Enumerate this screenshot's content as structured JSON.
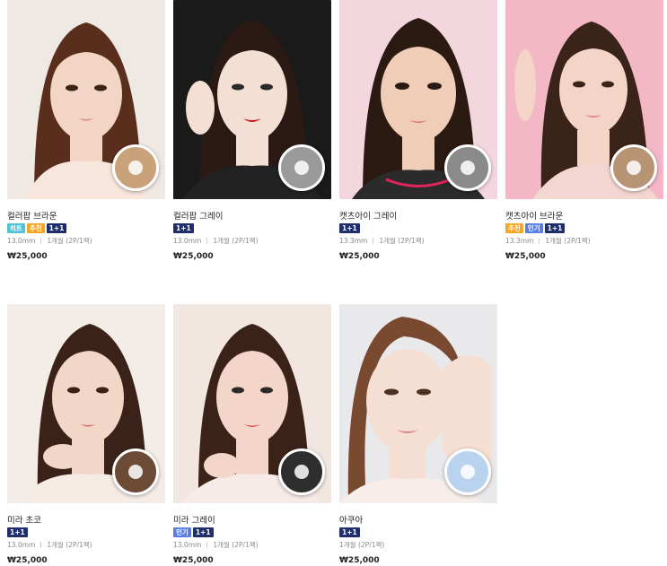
{
  "products": [
    {
      "name": "컬러팝 브라운",
      "badges": [
        {
          "label": "히트",
          "kind": "hit"
        },
        {
          "label": "추천",
          "kind": "rec"
        },
        {
          "label": "1+1",
          "kind": "one"
        }
      ],
      "diameter": "13.0mm",
      "package": "1개월 (2P/1팩)",
      "price": "₩25,000",
      "bg_color": "#efe9e4",
      "lens_color": "#c9a27a"
    },
    {
      "name": "컬러팝 그레이",
      "badges": [
        {
          "label": "1+1",
          "kind": "one"
        }
      ],
      "diameter": "13.0mm",
      "package": "1개월 (2P/1팩)",
      "price": "₩25,000",
      "bg_color": "#1a1a1a",
      "lens_color": "#9a9a9a"
    },
    {
      "name": "캣츠아이 그레이",
      "badges": [
        {
          "label": "1+1",
          "kind": "one"
        }
      ],
      "diameter": "13.3mm",
      "package": "1개월 (2P/1팩)",
      "price": "₩25,000",
      "bg_color": "#f4d6de",
      "lens_color": "#8a8a8a"
    },
    {
      "name": "캣츠아이 브라운",
      "badges": [
        {
          "label": "추천",
          "kind": "rec"
        },
        {
          "label": "인기",
          "kind": "pop"
        },
        {
          "label": "1+1",
          "kind": "one"
        }
      ],
      "diameter": "13.3mm",
      "package": "1개월 (2P/1팩)",
      "price": "₩25,000",
      "bg_color": "#f3b7c6",
      "lens_color": "#b79473"
    },
    {
      "name": "미라 초코",
      "badges": [
        {
          "label": "1+1",
          "kind": "one"
        }
      ],
      "diameter": "13.0mm",
      "package": "1개월 (2P/1팩)",
      "price": "₩25,000",
      "bg_color": "#f4ece6",
      "lens_color": "#6b4a36"
    },
    {
      "name": "미라 그레이",
      "badges": [
        {
          "label": "인기",
          "kind": "pop"
        },
        {
          "label": "1+1",
          "kind": "one"
        }
      ],
      "diameter": "13.0mm",
      "package": "1개월 (2P/1팩)",
      "price": "₩25,000",
      "bg_color": "#f2e6e0",
      "lens_color": "#2e2e2e"
    },
    {
      "name": "아쿠아",
      "badges": [
        {
          "label": "1+1",
          "kind": "one"
        }
      ],
      "diameter": "",
      "package": "1개월 (2P/1팩)",
      "price": "₩25,000",
      "bg_color": "#e9e9ec",
      "lens_color": "#b9d3ee"
    }
  ]
}
